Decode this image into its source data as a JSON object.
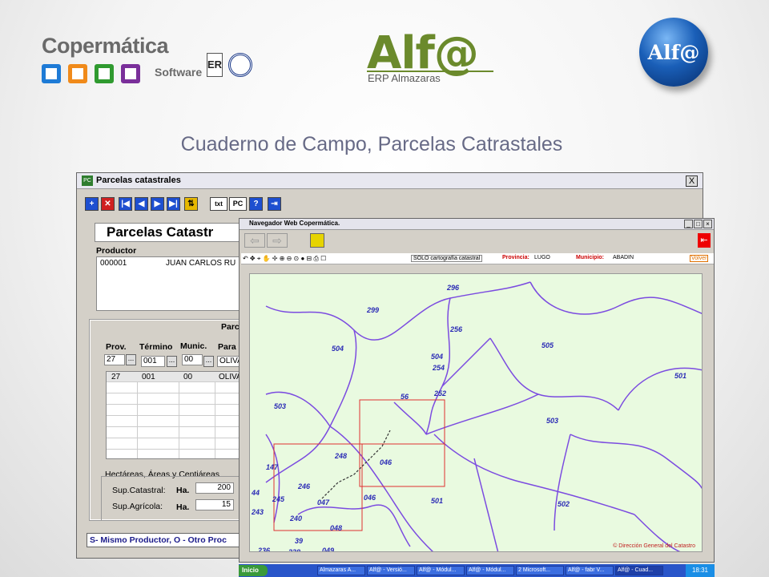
{
  "header": {
    "company_name": "Copermática",
    "company_sub": "Software",
    "cert_label": "ER",
    "product_logo": "Alf@",
    "product_sub": "ERP Almazaras",
    "badge_text": "Alf@",
    "square_colors": [
      "#1e7bd6",
      "#f08a1a",
      "#2f9a2f",
      "#7a2f9a"
    ]
  },
  "page_title": "Cuaderno de Campo, Parcelas Catrastales",
  "main_window": {
    "title": "Parcelas catastrales",
    "close": "X",
    "toolbar": [
      "+",
      "✕",
      "|◀",
      "◀",
      "▶",
      "▶|",
      "⇅",
      "txt",
      "PC",
      "?",
      "⇥"
    ],
    "form_title": "Parcelas Catastr",
    "productor_label": "Productor",
    "productor_code": "000001",
    "productor_name": "JUAN CARLOS RU",
    "section_label": "Parc",
    "col_prov": "Prov.",
    "col_termino": "Término",
    "col_munic": "Munic.",
    "col_para": "Para",
    "input_prov": "27",
    "input_termino": "001",
    "input_munic": "00",
    "input_para": "OLIVA",
    "dots": "...",
    "row": [
      "27",
      "001",
      "00",
      "OLIVA"
    ],
    "group_label": "Hectáreas, Áreas y Centiáreas",
    "sup_catastral_label": "Sup.Catastral:",
    "sup_agricola_label": "Sup.Agrícola:",
    "ha_label": "Ha.",
    "sup_catastral_ha": "200",
    "sup_agricola_ha": "15",
    "status": "S- Mismo Productor, O - Otro Proc"
  },
  "browser": {
    "title": "Navegador Web Copermática.",
    "layer_select": "SOLO cartografía catastral",
    "provincia_label": "Provincia:",
    "provincia": "LUGO",
    "municipio_label": "Municipio:",
    "municipio": "ABADIN",
    "volver": "Volver",
    "copyright": "© Dirección General del Catastro",
    "parcels": [
      "296",
      "299",
      "504",
      "256",
      "505",
      "504",
      "254",
      "501",
      "252",
      "56",
      "503",
      "503",
      "248",
      "046",
      "147",
      "246",
      "245",
      "047",
      "046",
      "501",
      "502",
      "44",
      "243",
      "240",
      "048",
      "39",
      "236",
      "238",
      "049"
    ]
  },
  "taskbar": {
    "start": "Inicio",
    "tasks": [
      "Almazaras A...",
      "Alf@ - Versió...",
      "Alf@ - Módul...",
      "Alf@ - Módul...",
      "2 Microsoft...",
      "Alf@ - fabr V...",
      "Alf@ - Cuad..."
    ],
    "clock": "18:31"
  }
}
